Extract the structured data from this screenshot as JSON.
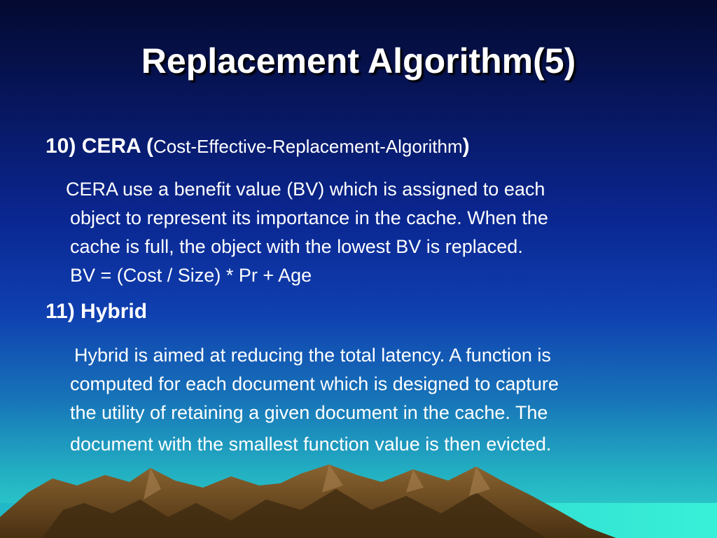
{
  "slide": {
    "title": "Replacement Algorithm(5)",
    "items": [
      {
        "number_label": "10) CERA",
        "open_paren": "(",
        "subtitle": "Cost-Effective-Replacement-Algorithm",
        "close_paren": ")",
        "lines": [
          "CERA use a benefit value (BV) which is assigned to each",
          "object to represent its importance in the cache. When the",
          "cache is full, the object with the lowest BV is replaced.",
          "BV = (Cost / Size) * Pr + Age"
        ]
      },
      {
        "number_label": "11) Hybrid",
        "lines": [
          "Hybrid is aimed at reducing the total latency. A function is",
          "computed for each document which is designed to capture",
          "the utility of retaining a given document in the cache. The",
          "document with the smallest function value is then evicted."
        ]
      }
    ]
  },
  "colors": {
    "background_top": "#040a30",
    "background_bottom": "#30d8d0",
    "text": "#ffffff",
    "mountains": "#6e4a1e"
  }
}
